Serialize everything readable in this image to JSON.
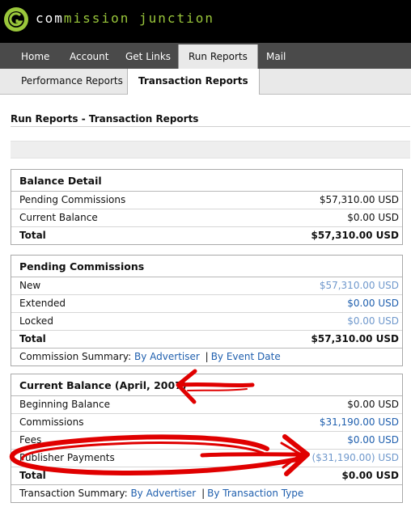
{
  "brand": {
    "name_part1": "com",
    "name_part2": "mission",
    "name_part3": " junction",
    "logo_glyph": "G",
    "colors": {
      "accent": "#9ac73b",
      "header_bg": "#000000",
      "nav_bg": "#4a4a4a",
      "link": "#1f5fae",
      "annotation": "#e00000"
    }
  },
  "main_nav": {
    "tabs": [
      {
        "label": "Home"
      },
      {
        "label": "Account"
      },
      {
        "label": "Get Links"
      },
      {
        "label": "Run Reports",
        "active": true
      },
      {
        "label": "Mail"
      }
    ]
  },
  "sub_nav": {
    "tabs": [
      {
        "label": "Performance Reports"
      },
      {
        "label": "Transaction Reports",
        "active": true
      }
    ]
  },
  "page": {
    "title": "Run Reports - Transaction Reports"
  },
  "balance_detail": {
    "heading": "Balance Detail",
    "rows": [
      {
        "label": "Pending Commissions",
        "value": "$57,310.00 USD"
      },
      {
        "label": "Current Balance",
        "value": "$0.00 USD"
      }
    ],
    "total": {
      "label": "Total",
      "value": "$57,310.00 USD"
    }
  },
  "pending_commissions": {
    "heading": "Pending Commissions",
    "rows": [
      {
        "label": "New",
        "value": "$57,310.00 USD"
      },
      {
        "label": "Extended",
        "value": "$0.00 USD"
      },
      {
        "label": "Locked",
        "value": "$0.00 USD"
      }
    ],
    "total": {
      "label": "Total",
      "value": "$57,310.00 USD"
    },
    "summary": {
      "label": "Commission Summary:",
      "link1": "By Advertiser",
      "separator": "|",
      "link2": "By Event Date"
    }
  },
  "current_balance": {
    "heading": "Current Balance (April, 2007)",
    "rows": [
      {
        "label": "Beginning Balance",
        "value": "$0.00 USD"
      },
      {
        "label": "Commissions",
        "value": "$31,190.00 USD"
      },
      {
        "label": "Fees",
        "value": "$0.00 USD"
      },
      {
        "label": "Publisher Payments",
        "value": "($31,190.00) USD"
      }
    ],
    "total": {
      "label": "Total",
      "value": "$0.00 USD"
    },
    "summary": {
      "label": "Transaction Summary:",
      "link1": "By Advertiser",
      "separator": "|",
      "link2": "By Transaction Type"
    }
  },
  "annotations": {
    "description_icon": "red-marker-arrow-icon"
  }
}
